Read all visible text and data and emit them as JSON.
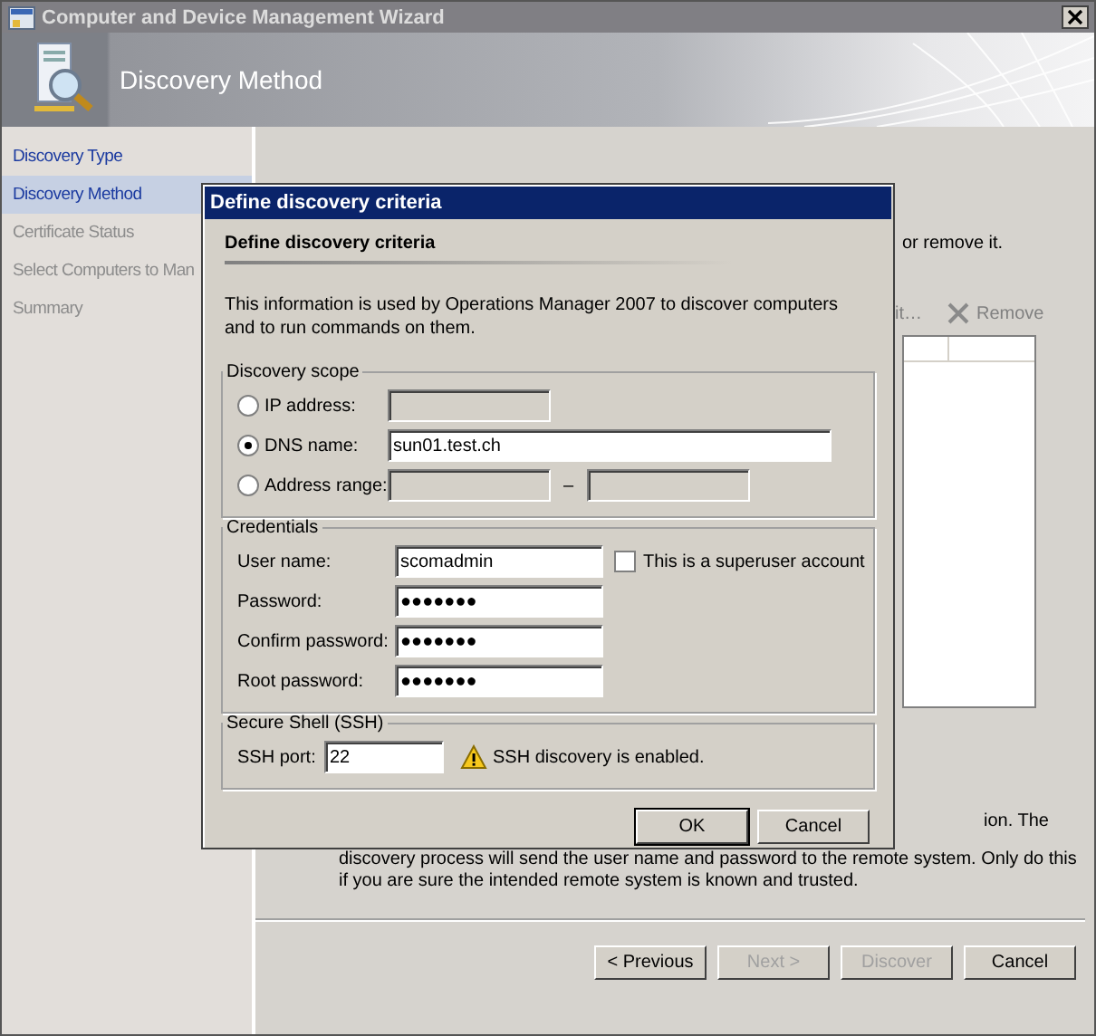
{
  "window": {
    "title": "Computer and Device Management Wizard"
  },
  "header": {
    "title": "Discovery Method"
  },
  "nav": {
    "items": [
      {
        "label": "Discovery Type",
        "selected": false,
        "disabled": false
      },
      {
        "label": "Discovery Method",
        "selected": true,
        "disabled": false
      },
      {
        "label": "Certificate Status",
        "selected": false,
        "disabled": true
      },
      {
        "label": "Select Computers to Man",
        "selected": false,
        "disabled": true
      },
      {
        "label": "Summary",
        "selected": false,
        "disabled": true
      }
    ]
  },
  "page": {
    "hint": "or remove it.",
    "toolbar": [
      {
        "label": "it…",
        "kind": "edit",
        "disabled": true
      },
      {
        "label": "Remove",
        "kind": "remove",
        "disabled": true
      }
    ],
    "note_lines": [
      "ion. The",
      "discovery process will send the user name and password to the remote system. Only do this",
      "if you are sure the intended remote system is known and trusted."
    ],
    "buttons": [
      {
        "label": "< Previous",
        "disabled": false
      },
      {
        "label": "Next >",
        "disabled": true
      },
      {
        "label": "Discover",
        "disabled": true
      },
      {
        "label": "Cancel",
        "disabled": false
      }
    ]
  },
  "dialog": {
    "title": "Define discovery criteria",
    "heading": "Define discovery criteria",
    "description": "This information is used by Operations Manager 2007 to discover computers and to run commands on them.",
    "scope": {
      "legend": "Discovery scope",
      "options": [
        {
          "label": "IP address:",
          "kind": "ip",
          "selected": false
        },
        {
          "label": "DNS name:",
          "kind": "text",
          "selected": true,
          "value": "sun01.test.ch"
        },
        {
          "label": "Address range:",
          "kind": "range",
          "selected": false,
          "separator": "–"
        }
      ]
    },
    "credentials": {
      "legend": "Credentials",
      "fields": [
        {
          "label": "User name:",
          "value": "scomadmin"
        },
        {
          "label": "Password:",
          "value": "●●●●●●●"
        },
        {
          "label": "Confirm password:",
          "value": "●●●●●●●"
        },
        {
          "label": "Root password:",
          "value": "●●●●●●●"
        }
      ],
      "superuser": {
        "label": "This is a superuser account",
        "checked": false
      }
    },
    "ssh": {
      "legend": "Secure Shell (SSH)",
      "port_label": "SSH port:",
      "port": "22",
      "status": "SSH discovery is enabled."
    },
    "buttons": [
      {
        "label": "OK",
        "default": true
      },
      {
        "label": "Cancel",
        "default": false
      }
    ]
  }
}
